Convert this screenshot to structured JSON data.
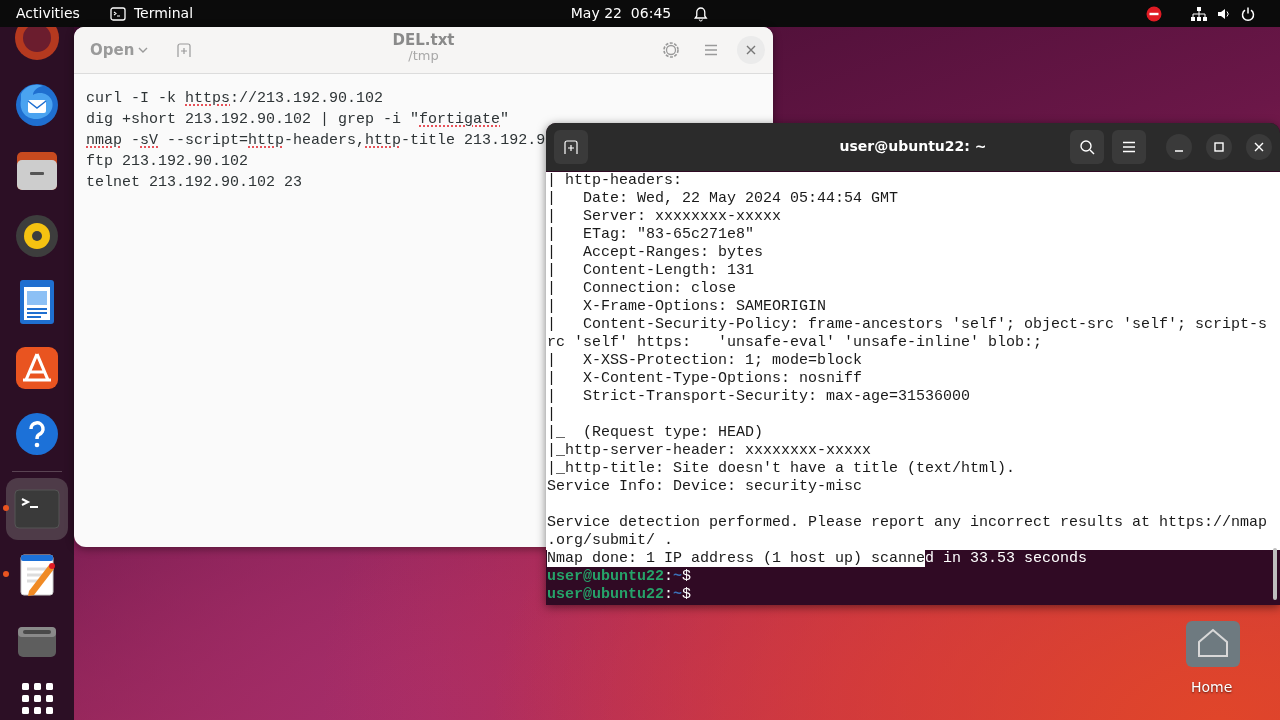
{
  "top_bar": {
    "activities": "Activities",
    "app_name": "Terminal",
    "date": "May 22",
    "time": "06:45"
  },
  "dock": {
    "items": [
      {
        "running": false,
        "active": false
      },
      {
        "running": false,
        "active": false
      },
      {
        "running": false,
        "active": false
      },
      {
        "running": false,
        "active": false
      },
      {
        "running": false,
        "active": false
      },
      {
        "running": false,
        "active": false
      },
      {
        "running": false,
        "active": false
      },
      {
        "running": true,
        "active": true
      },
      {
        "running": true,
        "active": false
      },
      {
        "running": false,
        "active": false
      }
    ]
  },
  "editor": {
    "open_button": "Open",
    "title": "DEL.txt",
    "subtitle": "/tmp",
    "lines": [
      {
        "segments": [
          {
            "text": "curl -I -k ",
            "misspelled": false
          },
          {
            "text": "https",
            "misspelled": true
          },
          {
            "text": "://213.192.90.102",
            "misspelled": false
          }
        ]
      },
      {
        "segments": [
          {
            "text": "dig +short 213.192.90.102 | grep -i \"",
            "misspelled": false
          },
          {
            "text": "fortigate",
            "misspelled": true
          },
          {
            "text": "\"",
            "misspelled": false
          }
        ]
      },
      {
        "segments": [
          {
            "text": "nmap",
            "misspelled": true
          },
          {
            "text": " -",
            "misspelled": false
          },
          {
            "text": "sV",
            "misspelled": true
          },
          {
            "text": " --script=",
            "misspelled": false
          },
          {
            "text": "http",
            "misspelled": true
          },
          {
            "text": "-headers,",
            "misspelled": false
          },
          {
            "text": "http",
            "misspelled": true
          },
          {
            "text": "-title 213.192.9",
            "misspelled": false
          }
        ]
      },
      {
        "segments": [
          {
            "text": "ftp 213.192.90.102",
            "misspelled": false
          }
        ]
      },
      {
        "segments": [
          {
            "text": "telnet 213.192.90.102 23",
            "misspelled": false
          }
        ]
      }
    ]
  },
  "terminal": {
    "title": "user@ubuntu22: ~",
    "lines": [
      {
        "kind": "text",
        "segments": [
          {
            "text": "| http-headers:",
            "selected": true
          }
        ]
      },
      {
        "kind": "text",
        "segments": [
          {
            "text": "|   Date: Wed, 22 May 2024 05:44:54 GMT",
            "selected": true
          }
        ]
      },
      {
        "kind": "text",
        "segments": [
          {
            "text": "|   Server: xxxxxxxx-xxxxx",
            "selected": true
          }
        ]
      },
      {
        "kind": "text",
        "segments": [
          {
            "text": "|   ETag: \"83-65c271e8\"",
            "selected": true
          }
        ]
      },
      {
        "kind": "text",
        "segments": [
          {
            "text": "|   Accept-Ranges: bytes",
            "selected": true
          }
        ]
      },
      {
        "kind": "text",
        "segments": [
          {
            "text": "|   Content-Length: 131",
            "selected": true
          }
        ]
      },
      {
        "kind": "text",
        "segments": [
          {
            "text": "|   Connection: close",
            "selected": true
          }
        ]
      },
      {
        "kind": "text",
        "segments": [
          {
            "text": "|   X-Frame-Options: SAMEORIGIN",
            "selected": true
          }
        ]
      },
      {
        "kind": "text",
        "segments": [
          {
            "text": "|   Content-Security-Policy: frame-ancestors 'self'; object-src 'self'; script-s",
            "selected": true
          }
        ]
      },
      {
        "kind": "text",
        "segments": [
          {
            "text": "rc 'self' https:   'unsafe-eval' 'unsafe-inline' blob:;",
            "selected": true
          }
        ]
      },
      {
        "kind": "text",
        "segments": [
          {
            "text": "|   X-XSS-Protection: 1; mode=block",
            "selected": true
          }
        ]
      },
      {
        "kind": "text",
        "segments": [
          {
            "text": "|   X-Content-Type-Options: nosniff",
            "selected": true
          }
        ]
      },
      {
        "kind": "text",
        "segments": [
          {
            "text": "|   Strict-Transport-Security: max-age=31536000",
            "selected": true
          }
        ]
      },
      {
        "kind": "text",
        "segments": [
          {
            "text": "|",
            "selected": true
          }
        ]
      },
      {
        "kind": "text",
        "segments": [
          {
            "text": "|_  (Request type: HEAD)",
            "selected": true
          }
        ]
      },
      {
        "kind": "text",
        "segments": [
          {
            "text": "|_http-server-header: xxxxxxxx-xxxxx",
            "selected": true
          }
        ]
      },
      {
        "kind": "text",
        "segments": [
          {
            "text": "|_http-title: Site doesn't have a title (text/html).",
            "selected": true
          }
        ]
      },
      {
        "kind": "text",
        "segments": [
          {
            "text": "Service Info: Device: security-misc",
            "selected": true
          }
        ]
      },
      {
        "kind": "blank",
        "selected": true
      },
      {
        "kind": "text",
        "segments": [
          {
            "text": "Service detection performed. Please report any incorrect results at https://nmap",
            "selected": true
          }
        ]
      },
      {
        "kind": "text",
        "segments": [
          {
            "text": ".org/submit/ .",
            "selected": true
          }
        ]
      },
      {
        "kind": "text",
        "segments": [
          {
            "text": "Nmap done: 1 IP address (1 host up) scanne",
            "selected": true
          },
          {
            "text": "d in 33.53 seconds",
            "selected": false
          }
        ]
      },
      {
        "kind": "prompt",
        "user": "user@ubuntu22",
        "separator": ":",
        "path": "~",
        "symbol": "$"
      },
      {
        "kind": "prompt",
        "user": "user@ubuntu22",
        "separator": ":",
        "path": "~",
        "symbol": "$"
      }
    ]
  },
  "desktop_icons": [
    {
      "label": "Home"
    }
  ]
}
